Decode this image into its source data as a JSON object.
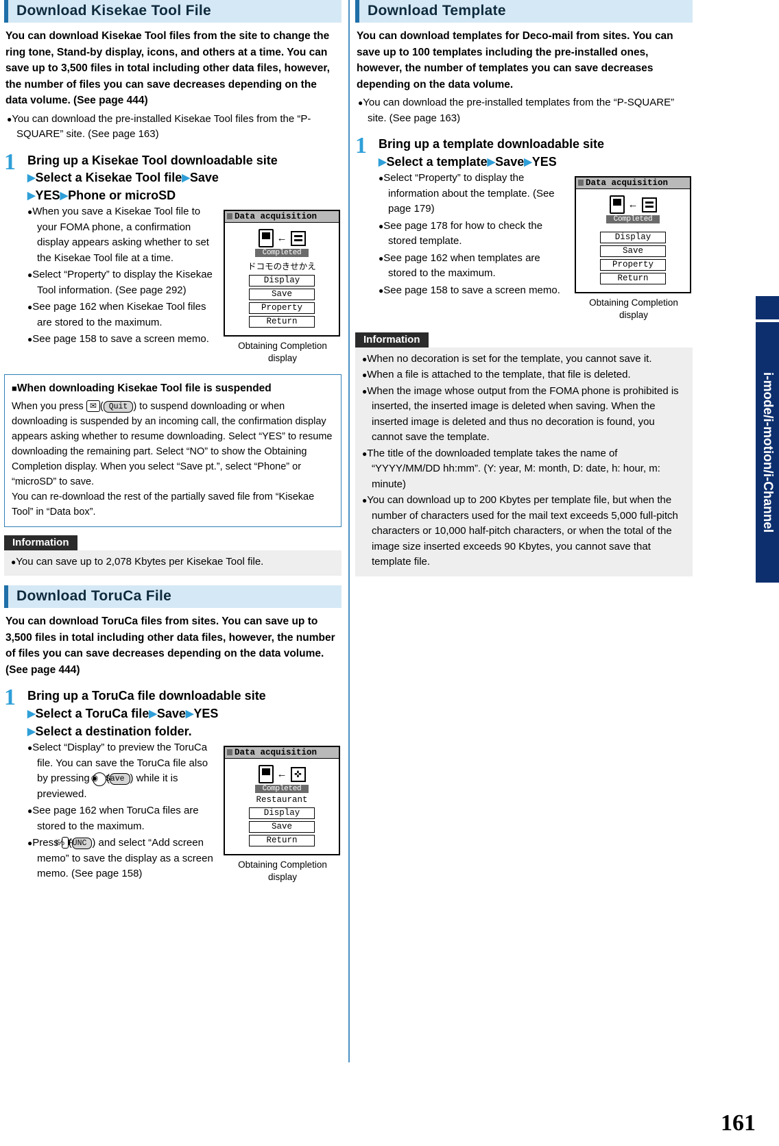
{
  "page_number": "161",
  "side_tab": "i-mode/i-motion/i-Channel",
  "left": {
    "section1": {
      "heading": "Download Kisekae Tool File",
      "intro": "You can download Kisekae Tool files from the site to change the ring tone, Stand-by display, icons, and others at a time. You can save up to 3,500 files in total including other data files, however, the number of files you can save decreases depending on the data volume. (See page 444)",
      "bullet": "You can download the pre-installed Kisekae Tool files from the “P-SQUARE” site. (See page 163)",
      "step": {
        "number": "1",
        "title_line1": "Bring up a Kisekae Tool downloadable site",
        "title_line2_a": "Select a Kisekae Tool file",
        "title_line2_b": "Save",
        "title_line3_a": "YES",
        "title_line3_b": "Phone or microSD"
      },
      "notes": [
        "When you save a Kisekae Tool file to your FOMA phone, a confirmation display appears asking whether to set the Kisekae Tool file at a time.",
        "Select “Property” to display the Kisekae Tool information. (See page 292)",
        "See page 162 when Kisekae Tool files are stored to the maximum.",
        "See page 158 to save a screen memo."
      ],
      "screenshot": {
        "title": "Data acquisition",
        "completed": "Completed",
        "subtitle": "ドコモのきせかえ",
        "buttons": [
          "Display",
          "Save",
          "Property",
          "Return"
        ],
        "caption_line1": "Obtaining Completion",
        "caption_line2": "display"
      }
    },
    "notebox": {
      "title": "When downloading Kisekae Tool file is suspended",
      "text_a": "When you press",
      "key_label": "✉",
      "softkey_label": "Quit",
      "text_b": ") to suspend downloading or when downloading is suspended by an incoming call, the confirmation display appears asking whether to resume downloading. Select “YES” to resume downloading the remaining part. Select “NO” to show the Obtaining Completion display. When you select “Save pt.”, select “Phone” or “microSD” to save.",
      "text_c": "You can re-download the rest of the partially saved file from “Kisekae Tool” in “Data box”."
    },
    "information1": {
      "heading": "Information",
      "items": [
        "You can save up to 2,078 Kbytes per Kisekae Tool file."
      ]
    },
    "section2": {
      "heading": "Download ToruCa File",
      "intro": "You can download ToruCa files from sites. You can save up to 3,500 files in total including other data files, however, the number of files you can save decreases depending on the data volume. (See page 444)",
      "step": {
        "number": "1",
        "title_line1": "Bring up a ToruCa file downloadable site",
        "title_line2_a": "Select a ToruCa file",
        "title_line2_b": "Save",
        "title_line2_c": "YES",
        "title_line3": "Select a destination folder."
      },
      "notes_1_a": "Select “Display” to preview the ToruCa file. You can save the ToruCa file also by pressing",
      "notes_1_softkey": "Save",
      "notes_1_b": ") while it is previewed.",
      "notes_2": "See page 162 when ToruCa files are stored to the maximum.",
      "notes_3_a": "Press",
      "notes_3_key": "i℅",
      "notes_3_softkey": "FUNC",
      "notes_3_b": ") and select “Add screen memo” to save the display as a screen memo. (See page 158)",
      "screenshot": {
        "title": "Data acquisition",
        "completed": "Completed",
        "subtitle": "Restaurant",
        "buttons": [
          "Display",
          "Save",
          "Return"
        ],
        "caption_line1": "Obtaining Completion",
        "caption_line2": "display"
      }
    }
  },
  "right": {
    "section1": {
      "heading": "Download Template",
      "intro": "You can download templates for Deco-mail from sites. You can save up to 100 templates including the pre-installed ones, however, the number of templates you can save decreases depending on the data volume.",
      "bullet": "You can download the pre-installed templates from the “P-SQUARE” site. (See page 163)",
      "step": {
        "number": "1",
        "title_line1": "Bring up a template downloadable site",
        "title_line2_a": "Select a template",
        "title_line2_b": "Save",
        "title_line2_c": "YES"
      },
      "notes": [
        "Select “Property” to display the information about the template. (See page 179)",
        "See page 178 for how to check the stored template.",
        "See page 162 when templates are stored to the maximum.",
        "See page 158 to save a screen memo."
      ],
      "screenshot": {
        "title": "Data acquisition",
        "completed": "Completed",
        "buttons": [
          "Display",
          "Save",
          "Property",
          "Return"
        ],
        "caption_line1": "Obtaining Completion",
        "caption_line2": "display"
      }
    },
    "information": {
      "heading": "Information",
      "items": [
        "When no decoration is set for the template, you cannot save it.",
        "When a file is attached to the template, that file is deleted.",
        "When the image whose output from the FOMA phone is prohibited is inserted, the inserted image is deleted when saving. When the inserted image is deleted and thus no decoration is found, you cannot save the template.",
        "The title of the downloaded template takes the name of “YYYY/MM/DD hh:mm”. (Y: year, M: month, D: date, h: hour, m: minute)",
        "You can download up to 200 Kbytes per template file, but when the number of characters used for the mail text exceeds 5,000 full-pitch characters or 10,000 half-pitch characters, or when the total of the image size inserted exceeds 90 Kbytes, you cannot save that template file."
      ]
    }
  }
}
